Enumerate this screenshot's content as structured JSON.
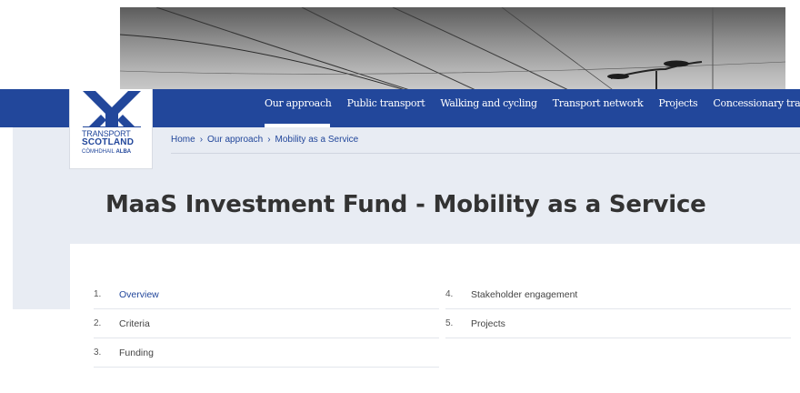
{
  "nav": {
    "items": [
      {
        "label": "Our approach",
        "active": true
      },
      {
        "label": "Public transport"
      },
      {
        "label": "Walking and cycling"
      },
      {
        "label": "Transport network"
      },
      {
        "label": "Projects"
      },
      {
        "label": "Concessionary travel"
      }
    ]
  },
  "logo": {
    "line1": "TRANSPORT",
    "line2": "SCOTLAND",
    "line3a": "CÒMHDHAIL",
    "line3b": "ALBA"
  },
  "breadcrumb": {
    "items": [
      "Home",
      "Our approach",
      "Mobility as a Service"
    ],
    "separator": "›"
  },
  "page": {
    "title": "MaaS Investment Fund - Mobility as a Service"
  },
  "contents": {
    "left": [
      {
        "num": "1.",
        "label": "Overview",
        "active": true
      },
      {
        "num": "2.",
        "label": "Criteria"
      },
      {
        "num": "3.",
        "label": "Funding"
      }
    ],
    "right": [
      {
        "num": "4.",
        "label": "Stakeholder engagement"
      },
      {
        "num": "5.",
        "label": "Projects"
      }
    ]
  },
  "colors": {
    "brand": "#22479b",
    "band": "#e8ecf3",
    "text": "#333333"
  }
}
